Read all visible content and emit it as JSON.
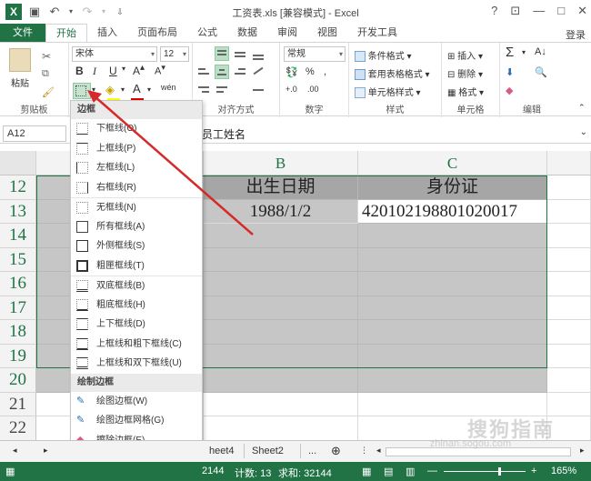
{
  "window": {
    "title": "工资表.xls [兼容模式] - Excel",
    "help": "?",
    "min": "—",
    "restore": "□",
    "close": "✕"
  },
  "tabs": [
    {
      "label": "文件"
    },
    {
      "label": "开始"
    },
    {
      "label": "插入"
    },
    {
      "label": "页面布局"
    },
    {
      "label": "公式"
    },
    {
      "label": "数据"
    },
    {
      "label": "审阅"
    },
    {
      "label": "视图"
    },
    {
      "label": "开发工具"
    }
  ],
  "signin": "登录",
  "ribbon": {
    "clipboard": {
      "paste": "粘贴",
      "label": "剪贴板"
    },
    "font": {
      "name": "宋体",
      "size": "12",
      "bold": "B",
      "italic": "I",
      "underline": "U",
      "fontcolor": "A",
      "phonetic": "wén"
    },
    "alignment": {
      "label": "对齐方式"
    },
    "number": {
      "format": "常规",
      "label": "数字"
    },
    "styles": {
      "cond": "条件格式",
      "table": "套用表格格式",
      "cell": "单元格样式",
      "label": "样式"
    },
    "cells": {
      "insert": "插入",
      "delete": "删除",
      "format": "格式",
      "label": "单元格"
    },
    "editing": {
      "sigma": "Σ",
      "label": "编辑"
    }
  },
  "formula": {
    "namebox": "A12",
    "content": "员工姓名"
  },
  "grid": {
    "columns": [
      "B",
      "C"
    ],
    "rows": [
      "12",
      "13",
      "14",
      "15",
      "16",
      "17",
      "18",
      "19",
      "20",
      "21",
      "22"
    ],
    "a12": "员",
    "b12": "出生日期",
    "c12": "身份证",
    "b13": "1988/1/2",
    "c13": "420102198801020017"
  },
  "menu": {
    "head1": "边框",
    "items1": [
      "下框线(O)",
      "上框线(P)",
      "左框线(L)",
      "右框线(R)",
      "无框线(N)",
      "所有框线(A)",
      "外侧框线(S)",
      "粗匣框线(T)",
      "双底框线(B)",
      "粗底框线(H)",
      "上下框线(D)",
      "上框线和粗下框线(C)",
      "上框线和双下框线(U)"
    ],
    "head2": "绘制边框",
    "items2": [
      "绘图边框(W)",
      "绘图边框网格(G)",
      "擦除边框(E)",
      "线条颜色(I)",
      "线型(Y)"
    ]
  },
  "sheets": [
    "heet4",
    "Sheet2",
    "..."
  ],
  "status": {
    "left": "2144",
    "count": "计数: 13",
    "sum": "求和: 32144",
    "zoom": "165%",
    "zoom_minus": "—",
    "zoom_plus": "+"
  },
  "watermark": {
    "main": "搜狗指南",
    "sub": "zhinan.sogou.com"
  },
  "colors": {
    "accent": "#217346",
    "arrow": "#d62a2a",
    "selection": "#c6c6c6"
  }
}
